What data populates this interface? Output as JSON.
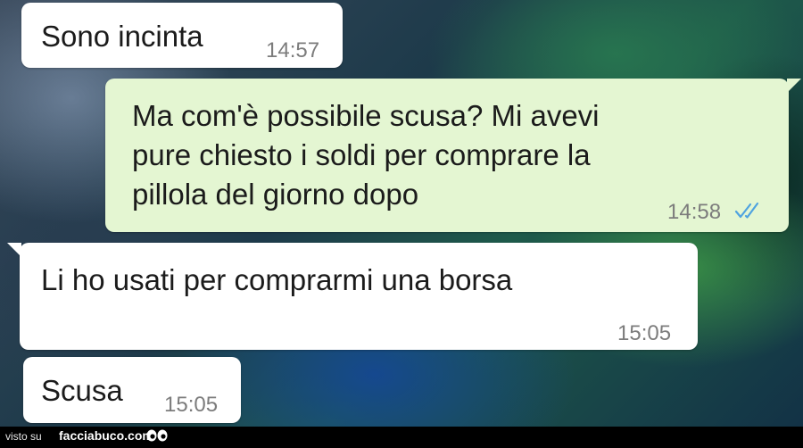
{
  "messages": [
    {
      "direction": "incoming",
      "text": "Sono incinta",
      "time": "14:57"
    },
    {
      "direction": "outgoing",
      "lines": [
        "Ma com'è possibile scusa? Mi avevi",
        "pure chiesto i soldi per comprare la",
        "pillola del giorno dopo"
      ],
      "time": "14:58",
      "status_icon": "double-check-read-icon"
    },
    {
      "direction": "incoming",
      "text": "Li ho usati per comprarmi una borsa",
      "time": "15:05"
    },
    {
      "direction": "incoming",
      "text": "Scusa",
      "time": "15:05"
    }
  ],
  "colors": {
    "incoming_bubble": "#ffffff",
    "outgoing_bubble": "#e4f6d2",
    "read_ticks": "#4fa3e0",
    "footer_bar": "#000000"
  },
  "watermark": {
    "prefix": "visto su",
    "brand": "facciabuco.com",
    "icon": "eyes-icon"
  }
}
